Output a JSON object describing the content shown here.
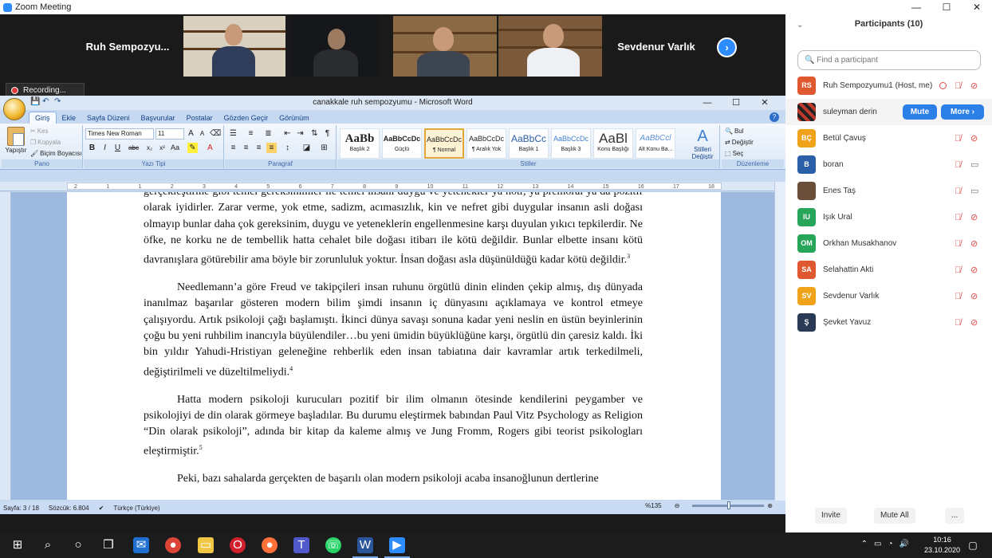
{
  "zoom": {
    "window_title": "Zoom Meeting",
    "recording_label": "Recording...",
    "name_tiles": [
      "Ruh Sempozyu...",
      "Sevdenur Varlık"
    ],
    "next_icon": "chevron-right-icon"
  },
  "window_controls": {
    "minimize": "—",
    "maximize": "☐",
    "close": "✕"
  },
  "word": {
    "title": "canakkale ruh sempozyumu - Microsoft Word",
    "tabs": [
      "Giriş",
      "Ekle",
      "Sayfa Düzeni",
      "Başvurular",
      "Postalar",
      "Gözden Geçir",
      "Görünüm"
    ],
    "clipboard": {
      "paste": "Yapıştır",
      "cut": "Kes",
      "copy": "Kopyala",
      "format_painter": "Biçim Boyacısı",
      "group": "Pano"
    },
    "font": {
      "name": "Times New Roman",
      "size": "11",
      "group": "Yazı Tipi"
    },
    "paragraph": {
      "group": "Paragraf"
    },
    "styles": {
      "group": "Stiller",
      "items": [
        {
          "sample": "AaBb",
          "name": "Başlık 2"
        },
        {
          "sample": "AaBbCcDc",
          "name": "Güçlü"
        },
        {
          "sample": "AaBbCcDc",
          "name": "¶ Normal"
        },
        {
          "sample": "AaBbCcDc",
          "name": "¶ Aralık Yok"
        },
        {
          "sample": "AaBbCc",
          "name": "Başlık 1"
        },
        {
          "sample": "AaBbCcDc",
          "name": "Başlık 3"
        },
        {
          "sample": "AaBl",
          "name": "Konu Başlığı"
        },
        {
          "sample": "AaBbCcl",
          "name": "Alt Konu Ba..."
        }
      ],
      "change_styles": "Stilleri Değiştir"
    },
    "editing": {
      "find": "Bul",
      "replace": "Değiştir",
      "select": "Seç",
      "group": "Düzenleme"
    },
    "ruler_numbers": [
      "2",
      "1",
      "1",
      "2",
      "3",
      "4",
      "5",
      "6",
      "7",
      "8",
      "9",
      "10",
      "11",
      "12",
      "13",
      "14",
      "15",
      "16",
      "17",
      "18"
    ],
    "paragraphs": [
      {
        "text": "gerçekleştirme gibi temel gereksinimler ile temel insani duygu ve yetenekler ya nötr, ya premoral ya da pozitif olarak iyidirler. Zarar verme, yok etme, sadizm, acımasızlık, kin ve nefret gibi duygular insanın asli doğası olmayıp bunlar daha çok gereksinim, duygu ve yeteneklerin engellenmesine karşı duyulan yıkıcı tepkilerdir. Ne öfke, ne korku ne de tembellik hatta cehalet bile doğası itibarı ile kötü değildir. Bunlar elbette insanı kötü davranışlara götürebilir ama böyle bir zorunluluk yoktur. İnsan doğası asla düşünüldüğü kadar kötü değildir.",
        "note": "3"
      },
      {
        "text": "Needlemann’a göre Freud ve takipçileri insan ruhunu örgütlü dinin elinden çekip almış, dış dünyada inanılmaz başarılar gösteren modern bilim şimdi insanın iç dünyasını açıklamaya ve kontrol etmeye çalışıyordu. Artık psikoloji çağı başlamıştı. İkinci dünya savaşı sonuna kadar yeni neslin en üstün beyinlerinin çoğu bu yeni ruhbilim inancıyla büyülendiler…bu yeni ümidin büyüklüğüne karşı, örgütlü din çaresiz kaldı. İki bin yıldır Yahudi-Hristiyan geleneğine rehberlik eden insan tabiatına dair kavramlar artık terkedilmeli, değiştirilmeli ve düzeltilmeliydi.",
        "note": "4"
      },
      {
        "text": "Hatta modern psikoloji kurucuları pozitif bir ilim olmanın ötesinde kendilerini peygamber ve psikolojiyi de din olarak görmeye başladılar. Bu durumu eleştirmek babından Paul Vitz Psychology as Religion “Din olarak psikoloji”, adında bir kitap da kaleme almış ve Jung Fromm, Rogers gibi teorist psikologları eleştirmiştir.",
        "note": "5"
      },
      {
        "text": "Peki, bazı sahalarda gerçekten de başarılı olan modern psikoloji acaba insanoğlunun dertlerine",
        "note": ""
      }
    ],
    "status": {
      "page": "Sayfa: 3 / 18",
      "words": "Sözcük: 6.804",
      "language": "Türkçe (Türkiye)",
      "zoom": "%135"
    }
  },
  "participants": {
    "title": "Participants (10)",
    "search_placeholder": "Find a participant",
    "mute_label": "Mute",
    "more_label": "More ›",
    "list": [
      {
        "initials": "RS",
        "name": "Ruh Sempozyumu1 (Host, me)",
        "color": "#e0582f",
        "cam": "off"
      },
      {
        "initials": "",
        "name": "suleyman derin",
        "color": "#c0392b",
        "cam": "none"
      },
      {
        "initials": "BÇ",
        "name": "Betül Çavuş",
        "color": "#f0a21a",
        "cam": "off"
      },
      {
        "initials": "B",
        "name": "boran",
        "color": "#2b5fa8",
        "cam": "on"
      },
      {
        "initials": "",
        "name": "Enes Taş",
        "color": "#6b4e3a",
        "cam": "on"
      },
      {
        "initials": "IU",
        "name": "Işık Ural",
        "color": "#27a65a",
        "cam": "off"
      },
      {
        "initials": "OM",
        "name": "Orkhan Musakhanov",
        "color": "#27a65a",
        "cam": "off"
      },
      {
        "initials": "SA",
        "name": "Selahattin Akti",
        "color": "#e0582f",
        "cam": "off"
      },
      {
        "initials": "SV",
        "name": "Sevdenur Varlık",
        "color": "#f0a21a",
        "cam": "off"
      },
      {
        "initials": "Ş",
        "name": "Şevket Yavuz",
        "color": "#2a3a55",
        "cam": "off"
      }
    ],
    "invite": "Invite",
    "mute_all": "Mute All",
    "more_dots": "..."
  },
  "taskbar": {
    "time": "10:16",
    "date": "23.10.2020"
  }
}
